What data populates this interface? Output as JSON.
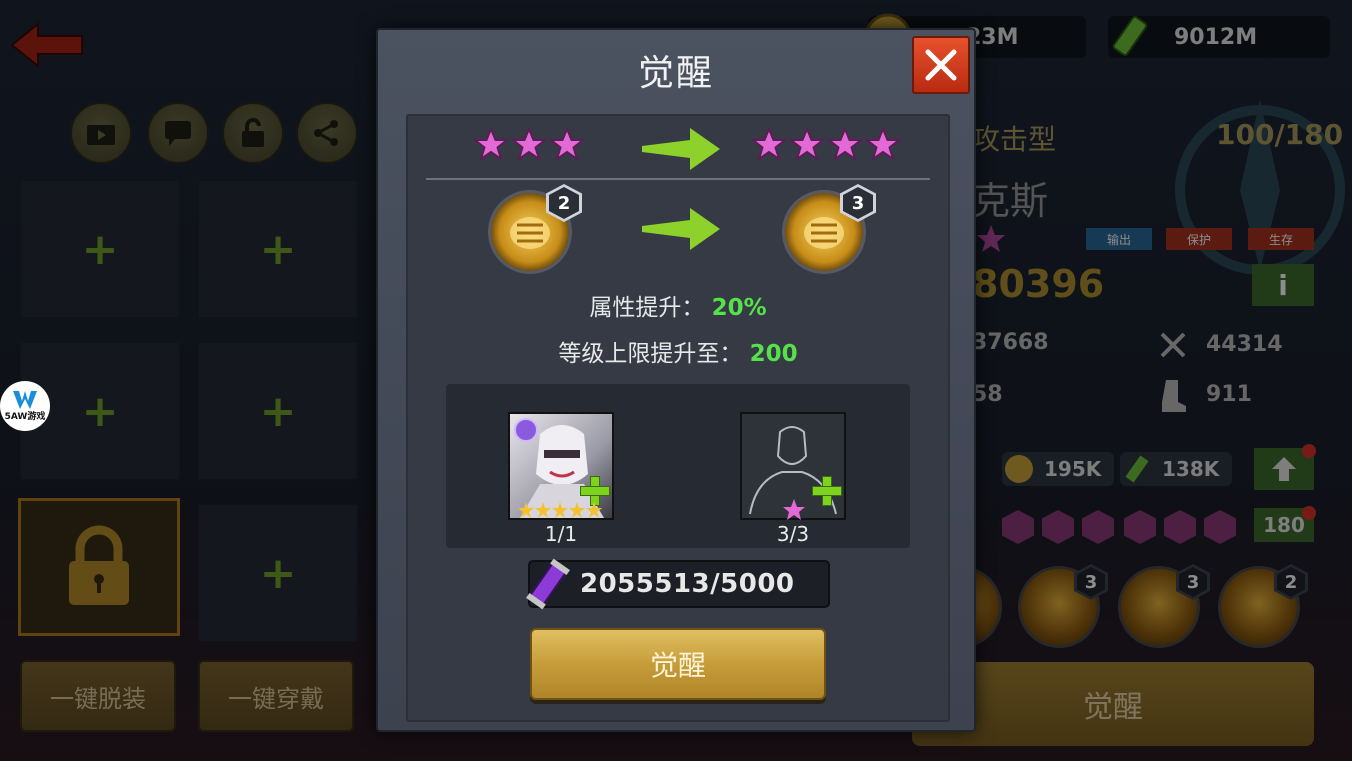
{
  "modal": {
    "title": "觉醒",
    "stars_before": 3,
    "stars_after": 4,
    "skill_level_before": "2",
    "skill_level_after": "3",
    "attr_label": "属性提升：",
    "attr_value": "20%",
    "level_label": "等级上限提升至：",
    "level_value": "200",
    "materials": [
      {
        "name": "hero-card",
        "count": "1/1",
        "stars": 5
      },
      {
        "name": "silhouette-card",
        "count": "3/3",
        "stars": 1
      }
    ],
    "cost": "2055513/5000",
    "confirm_label": "觉醒"
  },
  "background": {
    "currency": [
      "23M",
      "9012M"
    ],
    "hero_type": "攻击型",
    "hero_exp": "100/180",
    "hero_name": "克斯",
    "tags": [
      "输出",
      "保护",
      "生存"
    ],
    "power": "80396",
    "stats": [
      "37668",
      "44314",
      "58",
      "911"
    ],
    "upgrade_costs": [
      "195K",
      "138K"
    ],
    "level_badge": "180",
    "skill_levels": [
      "3",
      "3",
      "2"
    ],
    "unequip_all": "一键脱装",
    "equip_all": "一键穿戴",
    "awaken_bg": "觉醒"
  },
  "watermark": "5AW游戏",
  "colors": {
    "accent_green": "#56e04a",
    "close_red": "#d9401f",
    "gold_button": "#c79d3a",
    "star_pink": "#e36ad6"
  }
}
